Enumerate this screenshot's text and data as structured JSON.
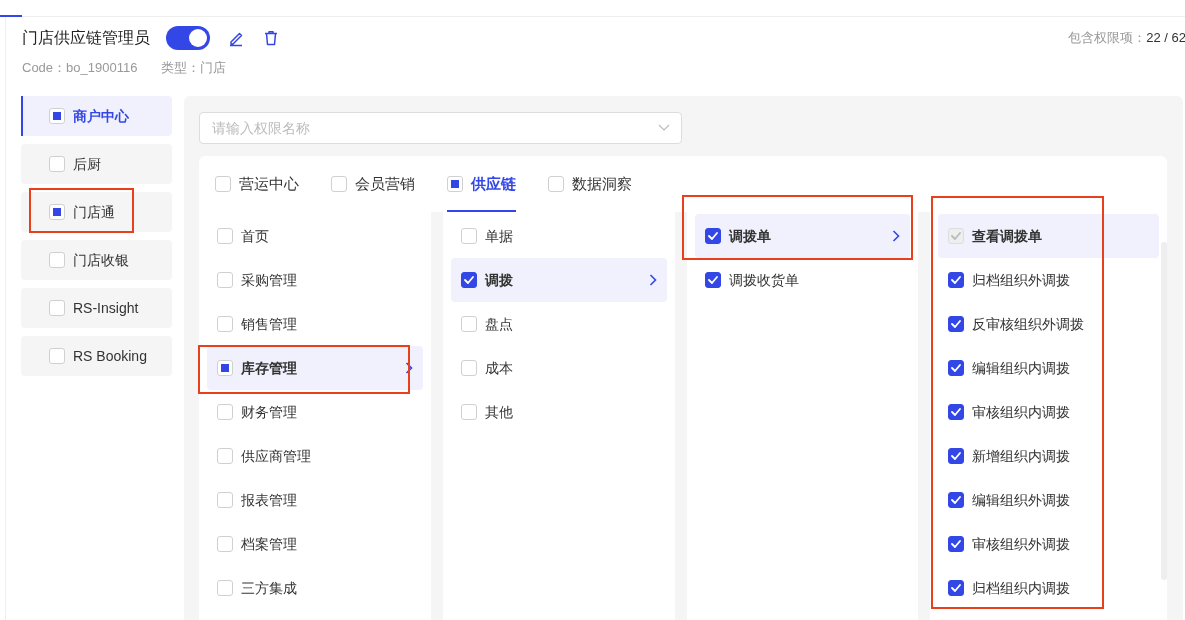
{
  "header": {
    "title": "门店供应链管理员",
    "enabled": true,
    "code_label": "Code：",
    "code": "bo_1900116",
    "type_label": "类型：",
    "type": "门店",
    "count_label": "包含权限项：",
    "count": "22 / 62"
  },
  "apps": [
    {
      "label": "商户中心",
      "selected": true,
      "checked": false,
      "indeterminate": true,
      "highlighted": false
    },
    {
      "label": "后厨",
      "selected": false,
      "checked": false,
      "indeterminate": false,
      "highlighted": false
    },
    {
      "label": "门店通",
      "selected": false,
      "checked": false,
      "indeterminate": true,
      "highlighted": true
    },
    {
      "label": "门店收银",
      "selected": false,
      "checked": false,
      "indeterminate": false,
      "highlighted": false
    },
    {
      "label": "RS-Insight",
      "selected": false,
      "checked": false,
      "indeterminate": false,
      "highlighted": false
    },
    {
      "label": "RS Booking",
      "selected": false,
      "checked": false,
      "indeterminate": false,
      "highlighted": false
    }
  ],
  "search": {
    "placeholder": "请输入权限名称"
  },
  "modules": [
    {
      "label": "营运中心",
      "selected": false,
      "checked": false,
      "indeterminate": false
    },
    {
      "label": "会员营销",
      "selected": false,
      "checked": false,
      "indeterminate": false
    },
    {
      "label": "供应链",
      "selected": true,
      "checked": false,
      "indeterminate": true
    },
    {
      "label": "数据洞察",
      "selected": false,
      "checked": false,
      "indeterminate": false
    }
  ],
  "columns": [
    {
      "highlighted": false,
      "items": [
        {
          "label": "首页",
          "checked": false,
          "indeterminate": false,
          "disabled": false,
          "selected": false,
          "highlighted": false
        },
        {
          "label": "采购管理",
          "checked": false,
          "indeterminate": false,
          "disabled": false,
          "selected": false,
          "highlighted": false
        },
        {
          "label": "销售管理",
          "checked": false,
          "indeterminate": false,
          "disabled": false,
          "selected": false,
          "highlighted": false
        },
        {
          "label": "库存管理",
          "checked": false,
          "indeterminate": true,
          "disabled": false,
          "selected": true,
          "highlighted": true
        },
        {
          "label": "财务管理",
          "checked": false,
          "indeterminate": false,
          "disabled": false,
          "selected": false,
          "highlighted": false
        },
        {
          "label": "供应商管理",
          "checked": false,
          "indeterminate": false,
          "disabled": false,
          "selected": false,
          "highlighted": false
        },
        {
          "label": "报表管理",
          "checked": false,
          "indeterminate": false,
          "disabled": false,
          "selected": false,
          "highlighted": false
        },
        {
          "label": "档案管理",
          "checked": false,
          "indeterminate": false,
          "disabled": false,
          "selected": false,
          "highlighted": false
        },
        {
          "label": "三方集成",
          "checked": false,
          "indeterminate": false,
          "disabled": false,
          "selected": false,
          "highlighted": false
        }
      ]
    },
    {
      "highlighted": false,
      "items": [
        {
          "label": "单据",
          "checked": false,
          "indeterminate": false,
          "disabled": false,
          "selected": false,
          "highlighted": false
        },
        {
          "label": "调拨",
          "checked": true,
          "indeterminate": false,
          "disabled": false,
          "selected": true,
          "highlighted": false
        },
        {
          "label": "盘点",
          "checked": false,
          "indeterminate": false,
          "disabled": false,
          "selected": false,
          "highlighted": false
        },
        {
          "label": "成本",
          "checked": false,
          "indeterminate": false,
          "disabled": false,
          "selected": false,
          "highlighted": false
        },
        {
          "label": "其他",
          "checked": false,
          "indeterminate": false,
          "disabled": false,
          "selected": false,
          "highlighted": false
        }
      ]
    },
    {
      "highlighted": false,
      "items": [
        {
          "label": "调拨单",
          "checked": true,
          "indeterminate": false,
          "disabled": false,
          "selected": true,
          "highlighted": true
        },
        {
          "label": "调拨收货单",
          "checked": true,
          "indeterminate": false,
          "disabled": false,
          "selected": false,
          "highlighted": false
        }
      ]
    },
    {
      "highlighted": true,
      "items": [
        {
          "label": "查看调拨单",
          "checked": true,
          "indeterminate": false,
          "disabled": true,
          "selected": true,
          "highlighted": false
        },
        {
          "label": "归档组织外调拨",
          "checked": true,
          "indeterminate": false,
          "disabled": false,
          "selected": false,
          "highlighted": false
        },
        {
          "label": "反审核组织外调拨",
          "checked": true,
          "indeterminate": false,
          "disabled": false,
          "selected": false,
          "highlighted": false
        },
        {
          "label": "编辑组织内调拨",
          "checked": true,
          "indeterminate": false,
          "disabled": false,
          "selected": false,
          "highlighted": false
        },
        {
          "label": "审核组织内调拨",
          "checked": true,
          "indeterminate": false,
          "disabled": false,
          "selected": false,
          "highlighted": false
        },
        {
          "label": "新增组织内调拨",
          "checked": true,
          "indeterminate": false,
          "disabled": false,
          "selected": false,
          "highlighted": false
        },
        {
          "label": "编辑组织外调拨",
          "checked": true,
          "indeterminate": false,
          "disabled": false,
          "selected": false,
          "highlighted": false
        },
        {
          "label": "审核组织外调拨",
          "checked": true,
          "indeterminate": false,
          "disabled": false,
          "selected": false,
          "highlighted": false
        },
        {
          "label": "归档组织内调拨",
          "checked": true,
          "indeterminate": false,
          "disabled": false,
          "selected": false,
          "highlighted": false
        }
      ]
    }
  ]
}
